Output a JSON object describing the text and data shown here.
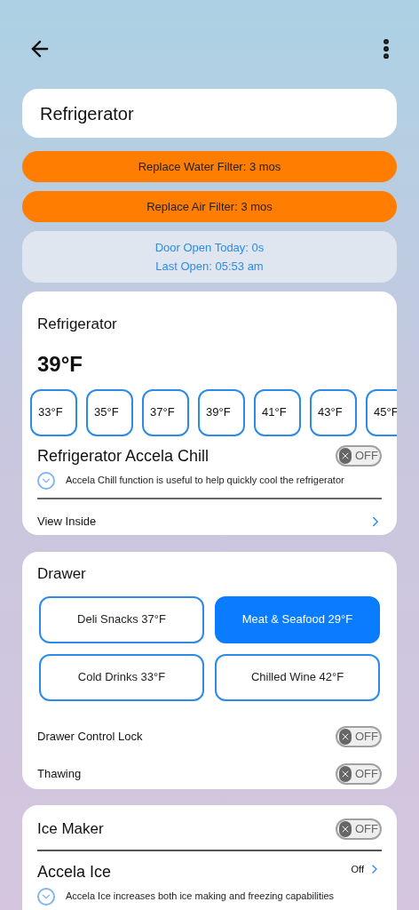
{
  "title": "Refrigerator",
  "alerts": [
    "Replace Water Filter: 3 mos",
    "Replace Air Filter: 3 mos"
  ],
  "door_info": [
    "Door Open Today: 0s",
    "Last Open: 05:53 am"
  ],
  "fridge": {
    "title": "Refrigerator",
    "temperature": "39°F",
    "temps": [
      {
        "label": "33°F",
        "selected": false
      },
      {
        "label": "35°F",
        "selected": false
      },
      {
        "label": "37°F",
        "selected": false
      },
      {
        "label": "39°F",
        "selected": false
      },
      {
        "label": "41°F",
        "selected": false
      },
      {
        "label": "43°F",
        "selected": false
      },
      {
        "label": "45°F",
        "selected": false
      }
    ],
    "accela_chill": {
      "title": "Refrigerator Accela Chill",
      "toggle": {
        "on": false,
        "label": "OFF"
      },
      "description": "Accela Chill function is useful to help quickly cool the refrigerator"
    },
    "view_inside": "View Inside"
  },
  "drawer": {
    "title": "Drawer",
    "options": [
      {
        "label": "Deli Snacks 37°F",
        "selected": false
      },
      {
        "label": "Meat & Seafood 29°F",
        "selected": true
      },
      {
        "label": "Cold Drinks 33°F",
        "selected": false
      },
      {
        "label": "Chilled Wine 42°F",
        "selected": false
      }
    ],
    "settings": [
      {
        "label": "Drawer Control Lock",
        "toggle": {
          "on": false,
          "label": "OFF"
        }
      },
      {
        "label": "Thawing",
        "toggle": {
          "on": false,
          "label": "OFF"
        }
      }
    ]
  },
  "ice": {
    "title": "Ice Maker",
    "toggle": {
      "on": false,
      "label": "OFF"
    },
    "accela_ice": {
      "title": "Accela Ice",
      "status": "Off",
      "description": "Accela Ice increases both ice making and freezing capabilities"
    }
  }
}
